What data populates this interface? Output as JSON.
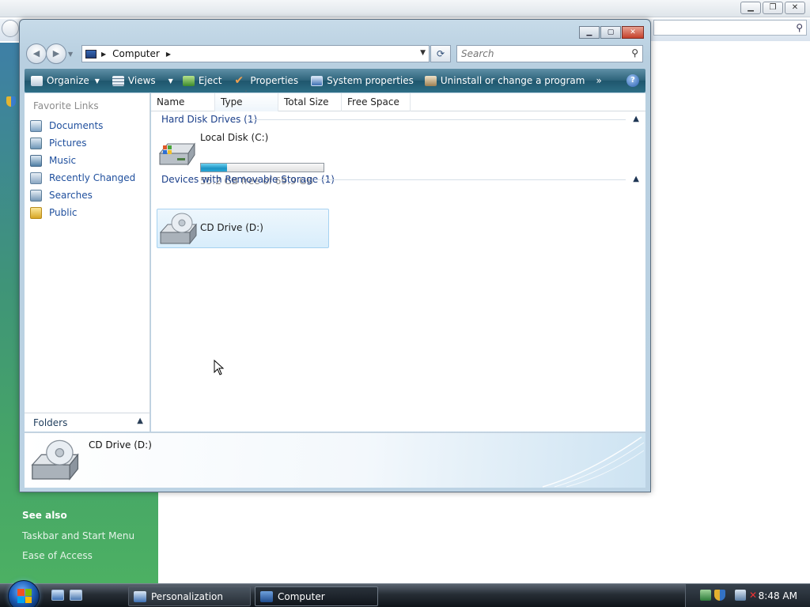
{
  "background_window": {
    "see_also": "See also",
    "links": [
      "Taskbar and Start Menu",
      "Ease of Access"
    ]
  },
  "window": {
    "address": {
      "crumb": "Computer"
    },
    "search": {
      "placeholder": "Search"
    },
    "toolbar": {
      "items": [
        {
          "label": "Organize",
          "icon": "organize-icon",
          "dropdown": true
        },
        {
          "label": "Views",
          "icon": "views-icon",
          "dropdown": true
        },
        {
          "label": "Eject",
          "icon": "eject-icon"
        },
        {
          "label": "Properties",
          "icon": "properties-icon"
        },
        {
          "label": "System properties",
          "icon": "system-properties-icon"
        },
        {
          "label": "Uninstall or change a program",
          "icon": "uninstall-icon"
        }
      ],
      "more": "»",
      "help": "?"
    },
    "nav_pane": {
      "title": "Favorite Links",
      "items": [
        {
          "label": "Documents",
          "icon": "documents-icon"
        },
        {
          "label": "Pictures",
          "icon": "pictures-icon"
        },
        {
          "label": "Music",
          "icon": "music-icon"
        },
        {
          "label": "Recently Changed",
          "icon": "recently-changed-icon"
        },
        {
          "label": "Searches",
          "icon": "searches-icon"
        },
        {
          "label": "Public",
          "icon": "public-folder-icon"
        }
      ],
      "folders_label": "Folders"
    },
    "columns": [
      "Name",
      "Type",
      "Total Size",
      "Free Space"
    ],
    "groups": [
      {
        "header": "Hard Disk Drives (1)",
        "items": [
          {
            "name": "Local Disk (C:)",
            "free_text": "55.2 GB free of 69.9 GB",
            "used_fraction": 0.21
          }
        ]
      },
      {
        "header": "Devices with Removable Storage (1)",
        "items": [
          {
            "name": "CD Drive (D:)"
          }
        ]
      }
    ],
    "details": {
      "name": "CD Drive (D:)"
    }
  },
  "taskbar": {
    "tasks": [
      {
        "label": "Personalization",
        "icon": "personalization-icon"
      },
      {
        "label": "Computer",
        "icon": "computer-icon",
        "active": true
      }
    ],
    "clock": "8:48 AM"
  }
}
